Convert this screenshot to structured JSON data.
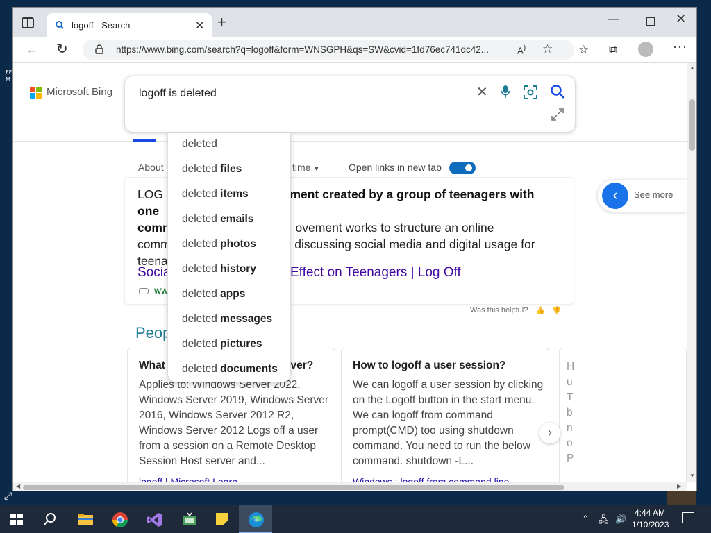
{
  "desktop": {
    "side_text": "FF\nM"
  },
  "browser": {
    "tab": {
      "title": "logoff - Search"
    },
    "address": {
      "url": "https://www.bing.com/search?q=logoff&form=WNSGPH&qs=SW&cvid=1fd76ec741dc42..."
    }
  },
  "bing": {
    "brand": "Microsoft Bing",
    "query": "logoff is deleted",
    "suggestions": [
      {
        "prefix": "deleted",
        "bold": ""
      },
      {
        "prefix": "deleted ",
        "bold": "files"
      },
      {
        "prefix": "deleted ",
        "bold": "items"
      },
      {
        "prefix": "deleted ",
        "bold": "emails"
      },
      {
        "prefix": "deleted ",
        "bold": "photos"
      },
      {
        "prefix": "deleted ",
        "bold": "history"
      },
      {
        "prefix": "deleted ",
        "bold": "apps"
      },
      {
        "prefix": "deleted ",
        "bold": "messages"
      },
      {
        "prefix": "deleted ",
        "bold": "pictures"
      },
      {
        "prefix": "deleted ",
        "bold": "documents"
      }
    ],
    "filters": {
      "about": "About",
      "time": "time",
      "open_new_tab": "Open links in new tab"
    },
    "result": {
      "line1_start": "LOG O",
      "line1_bold": "ment created by a group of teenagers with one",
      "line2_bold": "comm",
      "line2_rest": "ovement works to structure an online",
      "line3_start": "comm",
      "line3_rest": "d discussing social media and digital usage for",
      "line4_start": "teena",
      "link_left": "Socia",
      "link_right": "Effect on Teenagers | Log Off",
      "cite": "ww"
    },
    "helpful": "Was this helpful?",
    "see_more": "See more",
    "people_heading": "Peop",
    "qa": [
      {
        "question": "What i",
        "question_tail": "ver?",
        "answer": "Applies to: Windows Server 2022, Windows Server 2019, Windows Server 2016, Windows Server 2012 R2, Windows Server 2012 Logs off a user from a session on a Remote Desktop Session Host server and...",
        "source": "logoff | Microsoft Learn"
      },
      {
        "question": "How to logoff a user session?",
        "answer": "We can logoff a user session by clicking on the Logoff button in the start menu. We can logoff from command prompt(CMD) too using shutdown command. You need to run the below command. shutdown -L...",
        "source": "Windows : logoff from command line"
      }
    ],
    "qa_partial": "H u T b n o P"
  },
  "taskbar": {
    "time": "4:44 AM",
    "date": "1/10/2023"
  },
  "colors": {
    "accent": "#174ae4",
    "link": "#4007a2",
    "teal": "#1b7c94"
  }
}
